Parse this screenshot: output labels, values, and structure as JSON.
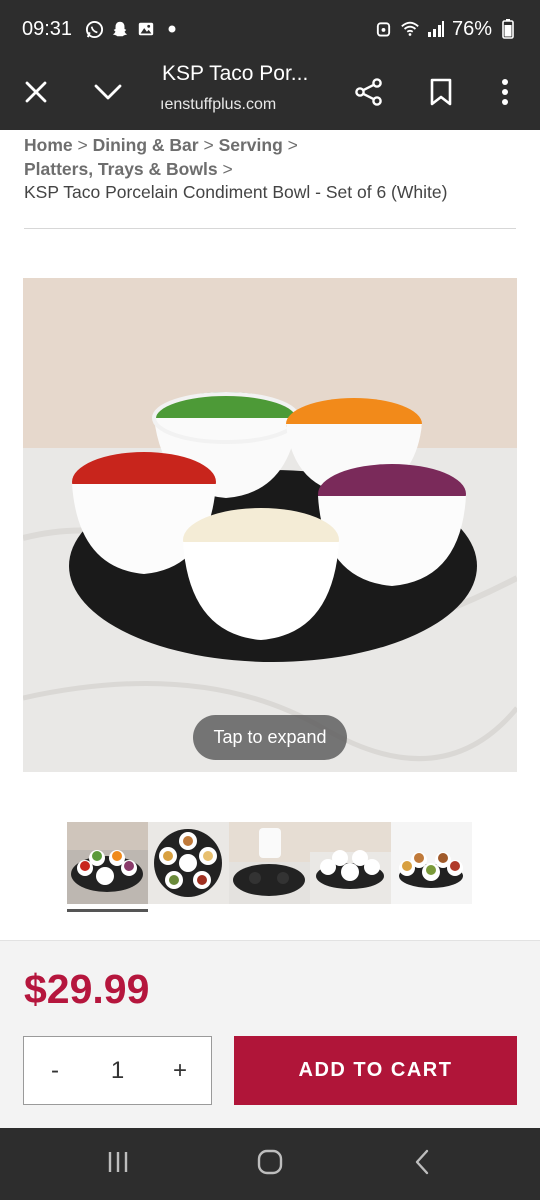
{
  "status_bar": {
    "time": "09:31",
    "battery": "76%"
  },
  "browser": {
    "title": "KSP Taco Por...",
    "url": "ıenstuffplus.com"
  },
  "breadcrumb": {
    "links": [
      "Home",
      "Dining & Bar",
      "Serving",
      "Platters, Trays & Bowls"
    ],
    "separator": ">",
    "current": "KSP Taco Porcelain Condiment Bowl - Set of 6 (White)"
  },
  "product": {
    "expand_label": "Tap to expand",
    "thumbnail_count": 5,
    "selected_thumbnail": 1
  },
  "purchase": {
    "price": "$29.99",
    "qty_minus": "-",
    "qty_value": "1",
    "qty_plus": "+",
    "add_to_cart": "ADD TO CART"
  },
  "colors": {
    "accent": "#b01539",
    "price": "#b5163d",
    "chrome": "#2d2d2d"
  }
}
